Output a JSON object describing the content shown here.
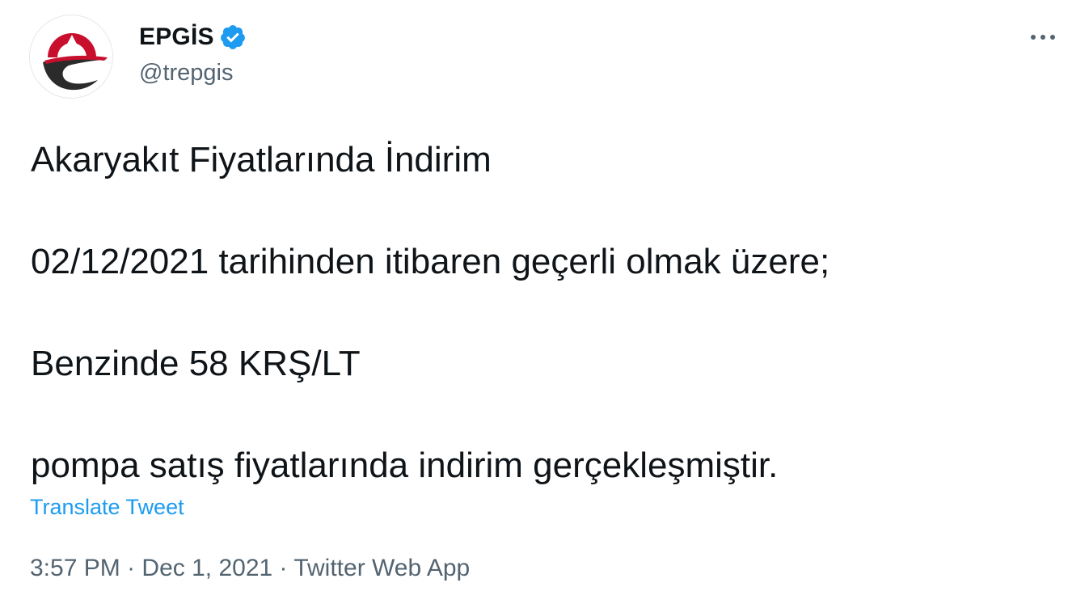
{
  "author": {
    "display_name": "EPGİS",
    "handle": "@trepgis",
    "verified": true,
    "avatar_icon": "epgis-logo",
    "verified_icon": "verified-badge-icon",
    "verified_color": "#1d9bf0"
  },
  "menu": {
    "more_icon": "more-horizontal-icon"
  },
  "tweet": {
    "lines": [
      "Akaryakıt Fiyatlarında İndirim",
      "02/12/2021 tarihinden itibaren geçerli olmak üzere;",
      "Benzinde 58 KRŞ/LT",
      "pompa satış fiyatlarında indirim gerçekleşmiştir."
    ],
    "translate_label": "Translate Tweet"
  },
  "meta": {
    "time": "3:57 PM",
    "separator": "·",
    "date": "Dec 1, 2021",
    "source": "Twitter Web App"
  },
  "colors": {
    "text": "#0f1419",
    "secondary": "#536471",
    "link": "#1d9bf0",
    "logo_red": "#c8102e",
    "logo_dark": "#2b2b2b"
  }
}
